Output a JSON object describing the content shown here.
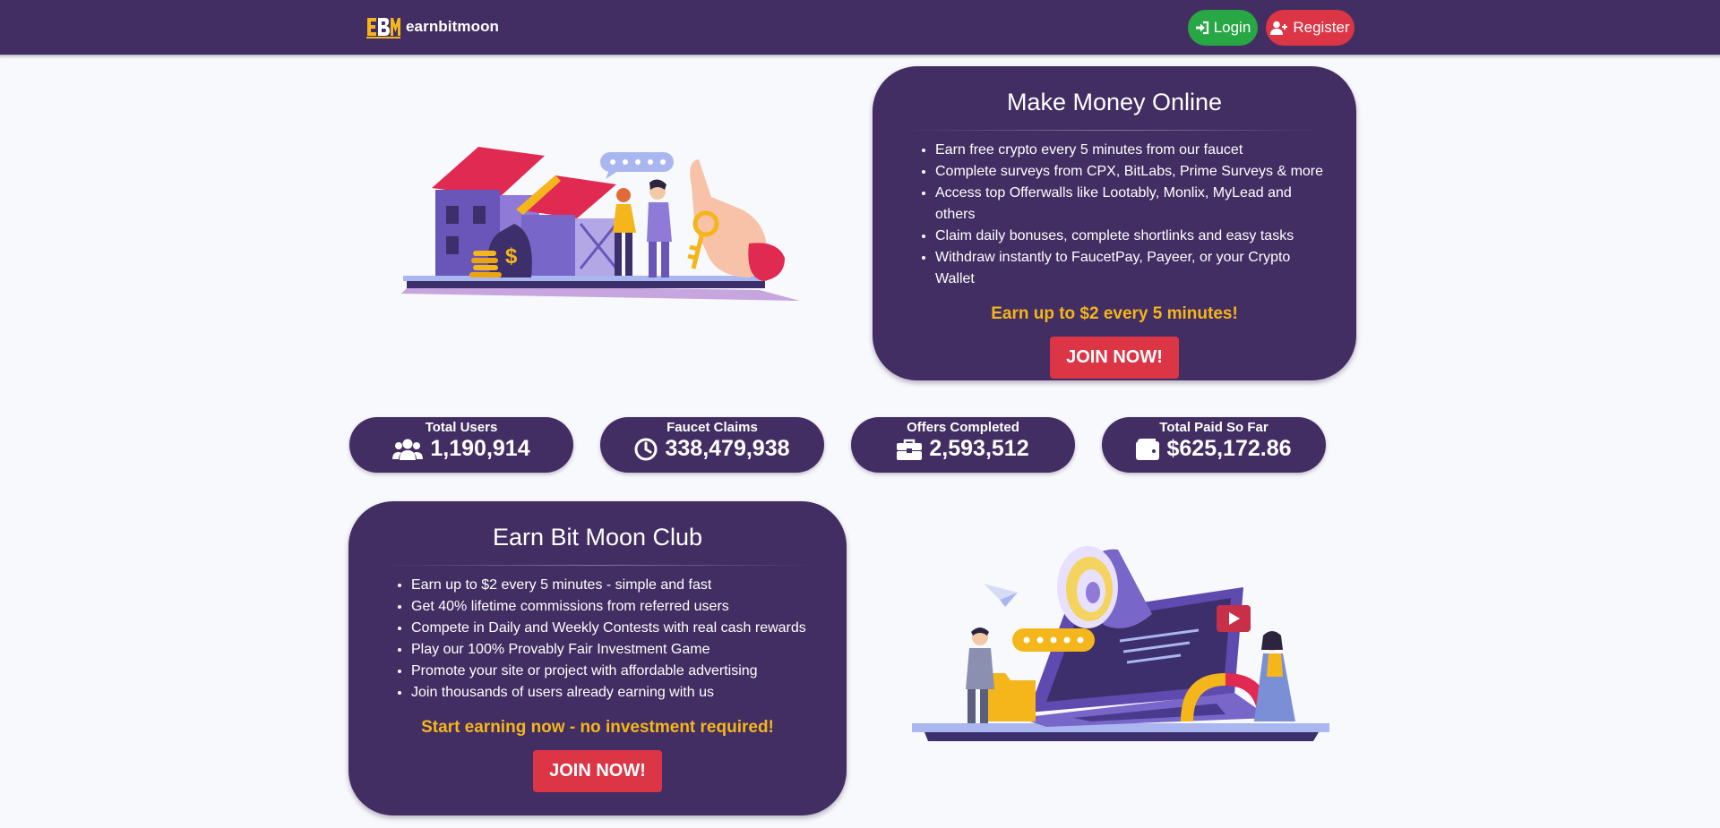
{
  "nav": {
    "brand_logo_text": "EBM",
    "brand_name": "earnbitmoon",
    "login_label": "Login",
    "register_label": "Register"
  },
  "hero": {
    "title": "Make Money Online",
    "items": [
      "Earn free crypto every 5 minutes from our faucet",
      "Complete surveys from CPX, BitLabs, Prime Surveys & more",
      "Access top Offerwalls like Lootably, Monlix, MyLead and others",
      "Claim daily bonuses, complete shortlinks and easy tasks",
      "Withdraw instantly to FaucetPay, Payeer, or your Crypto Wallet"
    ],
    "cta": "Earn up to $2 every 5 minutes!",
    "join_label": "JOIN NOW!"
  },
  "stats": [
    {
      "label": "Total Users",
      "value": "1,190,914",
      "icon": "users-icon"
    },
    {
      "label": "Faucet Claims",
      "value": "338,479,938",
      "icon": "clock-icon"
    },
    {
      "label": "Offers Completed",
      "value": "2,593,512",
      "icon": "briefcase-icon"
    },
    {
      "label": "Total Paid So Far",
      "value": "$625,172.86",
      "icon": "wallet-icon"
    }
  ],
  "club": {
    "title": "Earn Bit Moon Club",
    "items": [
      "Earn up to $2 every 5 minutes - simple and fast",
      "Get 40% lifetime commissions from referred users",
      "Compete in Daily and Weekly Contests with real cash rewards",
      "Play our 100% Provably Fair Investment Game",
      "Promote your site or project with affordable advertising",
      "Join thousands of users already earning with us"
    ],
    "cta": "Start earning now - no investment required!",
    "join_label": "JOIN NOW!"
  },
  "colors": {
    "nav_bg": "#422e62",
    "card_bg": "#422e62",
    "page_bg": "#f8f9fc",
    "login_green": "#28a745",
    "register_red": "#dc3545",
    "cta_yellow": "#f4b61b"
  }
}
